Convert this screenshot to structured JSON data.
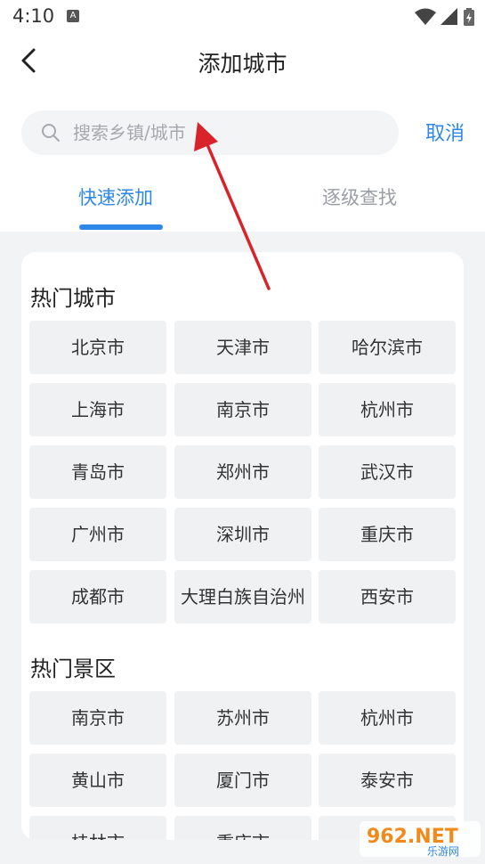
{
  "status_bar": {
    "time": "4:10",
    "notif_badge": "A"
  },
  "header": {
    "title": "添加城市"
  },
  "search": {
    "placeholder": "搜索乡镇/城市",
    "value": "",
    "cancel_label": "取消"
  },
  "tabs": [
    {
      "label": "快速添加",
      "active": true
    },
    {
      "label": "逐级查找",
      "active": false
    }
  ],
  "sections": [
    {
      "title": "热门城市",
      "items": [
        "北京市",
        "天津市",
        "哈尔滨市",
        "上海市",
        "南京市",
        "杭州市",
        "青岛市",
        "郑州市",
        "武汉市",
        "广州市",
        "深圳市",
        "重庆市",
        "成都市",
        "大理白族自治州",
        "西安市"
      ]
    },
    {
      "title": "热门景区",
      "items": [
        "南京市",
        "苏州市",
        "杭州市",
        "黄山市",
        "厦门市",
        "泰安市",
        "桂林市",
        "重庆市",
        ""
      ]
    }
  ],
  "colors": {
    "accent": "#2f87e8",
    "chip_bg": "#f0f1f3",
    "page_bg": "#f2f3f5",
    "arrow": "#d8232a"
  },
  "watermark": {
    "text": "962.NET",
    "sub": "乐游网"
  }
}
